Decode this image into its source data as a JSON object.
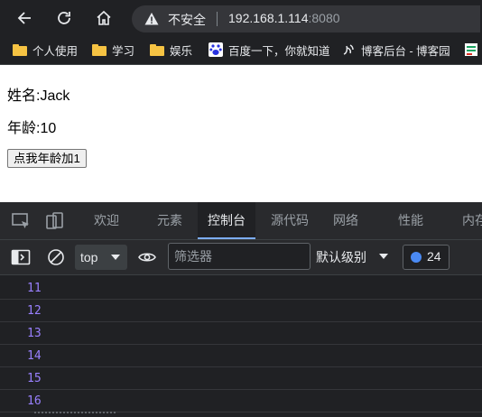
{
  "browser": {
    "security_label": "不安全",
    "url_host": "192.168.1.114",
    "url_port": ":8080",
    "bookmarks": [
      {
        "label": "个人使用",
        "icon": "folder-icon"
      },
      {
        "label": "学习",
        "icon": "folder-icon"
      },
      {
        "label": "娱乐",
        "icon": "folder-icon"
      },
      {
        "label": "百度一下，你就知道",
        "icon": "baidu-paw-icon"
      },
      {
        "label": "博客后台 - 博客园",
        "icon": "cnblogs-icon"
      }
    ]
  },
  "page": {
    "name_line": "姓名:Jack",
    "age_line": "年龄:10",
    "button_label": "点我年龄加1"
  },
  "devtools": {
    "tabs": [
      {
        "label": "欢迎"
      },
      {
        "label": "元素"
      },
      {
        "label": "控制台",
        "active": true
      },
      {
        "label": "源代码"
      },
      {
        "label": "网络"
      },
      {
        "label": "性能"
      },
      {
        "label": "内存"
      }
    ],
    "context": "top",
    "filter_placeholder": "筛选器",
    "level": "默认级别",
    "message_count": "24",
    "logs": [
      "11",
      "12",
      "13",
      "14",
      "15",
      "16"
    ]
  },
  "colors": {
    "chrome_bg": "#202124",
    "devtools_bg": "#292a2d",
    "active_tab_underline": "#7cacf8",
    "log_number": "#9980ff",
    "folder": "#f6c343"
  }
}
